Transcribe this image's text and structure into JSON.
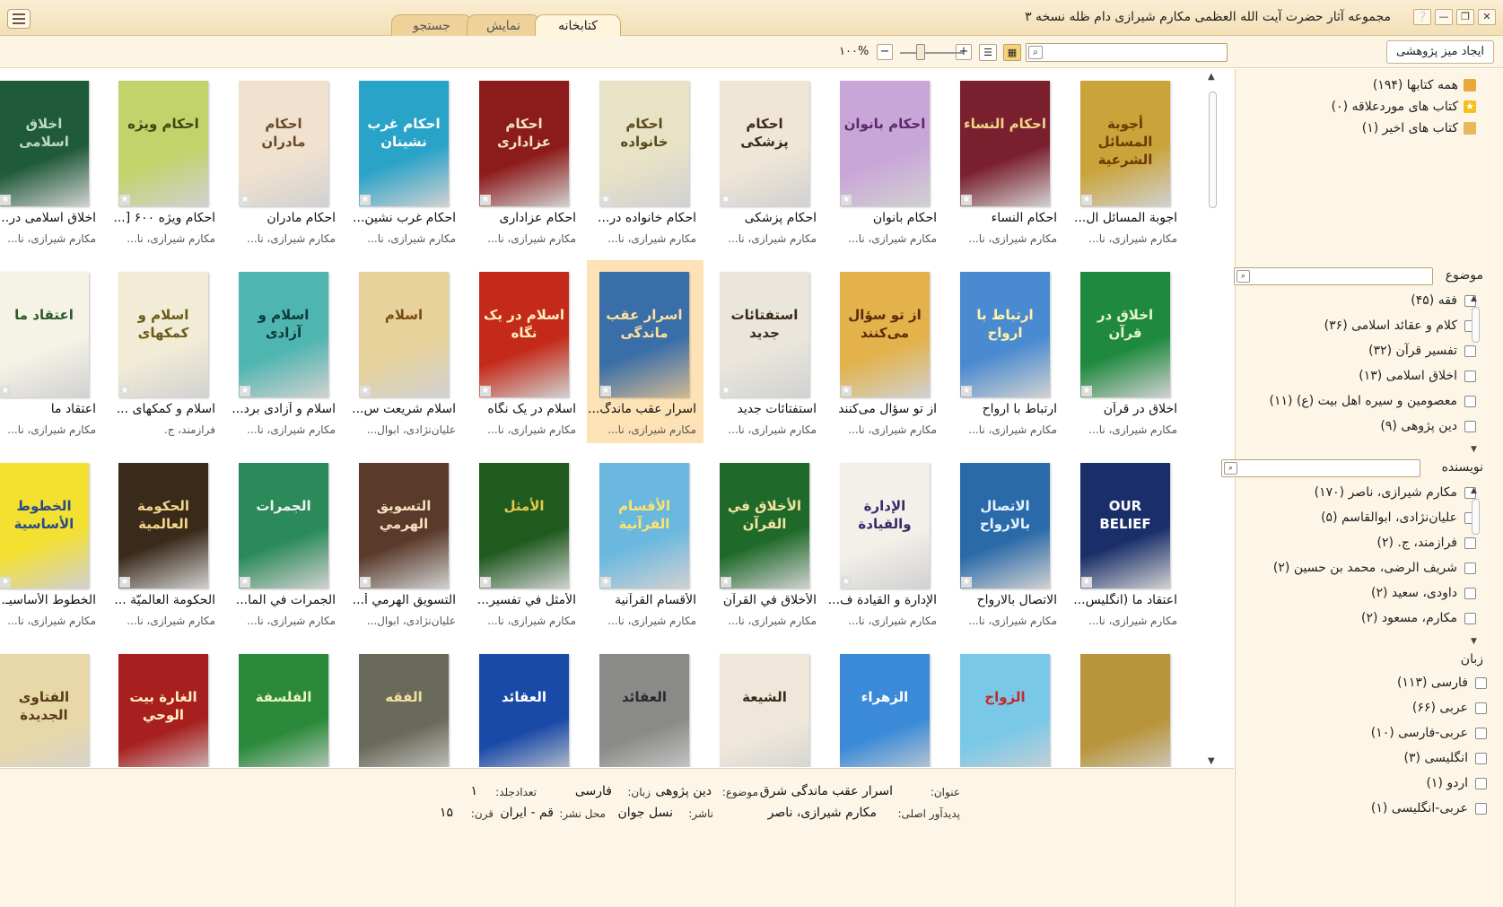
{
  "window": {
    "title": "مجموعه آثار حضرت آیت الله العظمی مکارم شیرازی دام ظله نسخه ۳",
    "controls": [
      "❔",
      "—",
      "❐",
      "✕"
    ]
  },
  "tabs": [
    {
      "label": "کتابخانه",
      "active": true
    },
    {
      "label": "نمایش",
      "active": false
    },
    {
      "label": "جستجو",
      "active": false
    }
  ],
  "toolbar": {
    "research_desk_label": "ایجاد میز پژوهشی",
    "search_placeholder": "",
    "zoom_label": "۱۰۰%",
    "zoom_plus": "+",
    "zoom_minus": "−",
    "view_mode": "grid"
  },
  "books": [
    {
      "title": "اجوبة المسائل ال...",
      "author": "مکارم شیرازی، نا...",
      "cover_title": "أجوبة المسائل الشرعية",
      "bg": "#caa43a",
      "fg": "#6b3b00"
    },
    {
      "title": "احکام النساء",
      "author": "مکارم شیرازی، نا...",
      "cover_title": "احکام النساء",
      "bg": "#7a1f2e",
      "fg": "#f3d58a"
    },
    {
      "title": "احکام بانوان",
      "author": "مکارم شیرازی، نا...",
      "cover_title": "احکام بانوان",
      "bg": "#c9a6d8",
      "fg": "#5a2a6a"
    },
    {
      "title": "احکام پزشکی",
      "author": "مکارم شیرازی، نا...",
      "cover_title": "احکام پزشکی",
      "bg": "#efe6d6",
      "fg": "#3a2a1a"
    },
    {
      "title": "احکام خانواده در...",
      "author": "مکارم شیرازی، نا...",
      "cover_title": "احکام خانواده",
      "bg": "#e8e2c6",
      "fg": "#5b4a1a"
    },
    {
      "title": "احکام عزاداری",
      "author": "مکارم شیرازی، نا...",
      "cover_title": "احکام عزاداری",
      "bg": "#8c1b1b",
      "fg": "#f3e4c4"
    },
    {
      "title": "احکام غرب نشین...",
      "author": "مکارم شیرازی، نا...",
      "cover_title": "احکام غرب نشینان",
      "bg": "#2aa3c9",
      "fg": "#ffffff"
    },
    {
      "title": "احکام مادران",
      "author": "مکارم شیرازی، نا...",
      "cover_title": "احکام مادران",
      "bg": "#f1e2cf",
      "fg": "#6b4a2a"
    },
    {
      "title": "احکام ویژه ۶۰۰ [...",
      "author": "مکارم شیرازی، نا...",
      "cover_title": "احکام ویژه",
      "bg": "#c3d36b",
      "fg": "#3a4a10"
    },
    {
      "title": "اخلاق اسلامی در...",
      "author": "مکارم شیرازی، نا...",
      "cover_title": "اخلاق اسلامی",
      "bg": "#1f5a3a",
      "fg": "#bcd9c4"
    },
    {
      "title": "اخلاق در قرآن",
      "author": "مکارم شیرازی، نا...",
      "cover_title": "اخلاق در قرآن",
      "bg": "#1f8a3f",
      "fg": "#e8f3d0"
    },
    {
      "title": "ارتباط با ارواح",
      "author": "مکارم شیرازی، نا...",
      "cover_title": "ارتباط با ارواح",
      "bg": "#4a8ad0",
      "fg": "#fff3a8"
    },
    {
      "title": "از تو سؤال می‌کنند",
      "author": "مکارم شیرازی، نا...",
      "cover_title": "از تو سؤال می‌کنند",
      "bg": "#e3b24a",
      "fg": "#5a2a10"
    },
    {
      "title": "استفتائات جدید",
      "author": "مکارم شیرازی، نا...",
      "cover_title": "استفتائات جدید",
      "bg": "#eae6dc",
      "fg": "#3a2a1a"
    },
    {
      "title": "اسرار عقب ماندگ...",
      "author": "مکارم شیرازی، نا...",
      "cover_title": "اسرار عقب ماندگی",
      "bg": "#3a6ea8",
      "fg": "#ffe0a0",
      "selected": true
    },
    {
      "title": "اسلام در یک نگاه",
      "author": "مکارم شیرازی، نا...",
      "cover_title": "اسلام در یک نگاه",
      "bg": "#c42a1a",
      "fg": "#fff2c0"
    },
    {
      "title": "اسلام شریعت س...",
      "author": "علیان‌نژادی، ابوال...",
      "cover_title": "اسلام",
      "bg": "#e6d29a",
      "fg": "#7a4a10"
    },
    {
      "title": "اسلام و آزادی برد...",
      "author": "مکارم شیرازی، نا...",
      "cover_title": "اسلام و آزادی",
      "bg": "#4fb5b0",
      "fg": "#0a3a3a"
    },
    {
      "title": "اسلام و کمکهای ...",
      "author": "فرازمند، ج.",
      "cover_title": "اسلام و کمکهای",
      "bg": "#f2ecd6",
      "fg": "#6a5a1a"
    },
    {
      "title": "اعتقاد ما",
      "author": "مکارم شیرازی، نا...",
      "cover_title": "اعتقاد ما",
      "bg": "#f5f2e6",
      "fg": "#2a5a2a"
    },
    {
      "title": "اعتقاد ما (انگلیس...",
      "author": "مکارم شیرازی، نا...",
      "cover_title": "OUR BELIEF",
      "bg": "#1a2f6a",
      "fg": "#ffffff"
    },
    {
      "title": "الاتصال بالارواح",
      "author": "مکارم شیرازی، نا...",
      "cover_title": "الاتصال بالارواح",
      "bg": "#2a6aa8",
      "fg": "#e6f3ff"
    },
    {
      "title": "الإدارة و القیادة ف...",
      "author": "مکارم شیرازی، نا...",
      "cover_title": "الإدارة والقيادة",
      "bg": "#f3f0ea",
      "fg": "#3a2a6a"
    },
    {
      "title": "الأخلاق في القرآن",
      "author": "مکارم شیرازی، نا...",
      "cover_title": "الأخلاق في القرآن",
      "bg": "#1f6a2a",
      "fg": "#f3e4a0"
    },
    {
      "title": "الأقسام القرآنیة",
      "author": "مکارم شیرازی، نا...",
      "cover_title": "الأقسام القرآنية",
      "bg": "#6ab8e0",
      "fg": "#ffe46a"
    },
    {
      "title": "الأمثل في تفسیر...",
      "author": "مکارم شیرازی، نا...",
      "cover_title": "الأمثل",
      "bg": "#1f5a1f",
      "fg": "#e8c84a"
    },
    {
      "title": "التسویق الهرمي أ...",
      "author": "علیان‌نژادی، ابوال...",
      "cover_title": "التسويق الهرمي",
      "bg": "#5a3a2a",
      "fg": "#f3e0c0"
    },
    {
      "title": "الجمرات في الما...",
      "author": "مکارم شیرازی، نا...",
      "cover_title": "الجمرات",
      "bg": "#2a8a5a",
      "fg": "#f3f3f3"
    },
    {
      "title": "الحکومة العالمیّة ...",
      "author": "مکارم شیرازی، نا...",
      "cover_title": "الحكومة العالمية",
      "bg": "#3a2a1a",
      "fg": "#f3d58a"
    },
    {
      "title": "الخطوط الأساسیـ...",
      "author": "مکارم شیرازی، نا...",
      "cover_title": "الخطوط الأساسية",
      "bg": "#f3e030",
      "fg": "#2a4a8a"
    },
    {
      "title": "",
      "author": "",
      "cover_title": "",
      "bg": "#b8943a",
      "fg": "#3a2a1a"
    },
    {
      "title": "",
      "author": "",
      "cover_title": "الزواج",
      "bg": "#7ac8e8",
      "fg": "#c02a2a"
    },
    {
      "title": "",
      "author": "",
      "cover_title": "الزهراء",
      "bg": "#3a8ad8",
      "fg": "#ffffff"
    },
    {
      "title": "",
      "author": "",
      "cover_title": "الشيعة",
      "bg": "#efe8da",
      "fg": "#3a2a1a"
    },
    {
      "title": "",
      "author": "",
      "cover_title": "العقائد",
      "bg": "#8a8a88",
      "fg": "#2a2a2a"
    },
    {
      "title": "",
      "author": "",
      "cover_title": "العقائد",
      "bg": "#1a4aa8",
      "fg": "#ffffff"
    },
    {
      "title": "",
      "author": "",
      "cover_title": "الفقه",
      "bg": "#6a6a5a",
      "fg": "#f3e0a0"
    },
    {
      "title": "",
      "author": "",
      "cover_title": "الفلسفة",
      "bg": "#2a8a3a",
      "fg": "#e8f3c0"
    },
    {
      "title": "",
      "author": "",
      "cover_title": "الغارة بيت الوحي",
      "bg": "#a81f1f",
      "fg": "#fff2c0"
    },
    {
      "title": "",
      "author": "",
      "cover_title": "الفتاوى الجديدة",
      "bg": "#e8d8a8",
      "fg": "#5a3a1a"
    }
  ],
  "info": {
    "title_label": "عنوان:",
    "title_value": "اسرار عقب ماندگی شرق",
    "subject_label": "موضوع:",
    "subject_value": "دین پژوهی",
    "language_label": "زبان:",
    "language_value": "فارسی",
    "volumes_label": "تعدادجلد:",
    "volumes_value": "۱",
    "author_label": "پدیدآور اصلی:",
    "author_value": "مکارم شیرازی، ناصر",
    "publisher_label": "ناشر:",
    "publisher_value": "نسل جوان",
    "place_label": "محل نشر:",
    "place_value": "قم - ایران",
    "century_label": "قرن:",
    "century_value": "۱۵"
  },
  "library": [
    {
      "label": "همه کتابها (۱۹۴)",
      "icon": "books-icon",
      "color": "#e8a83a"
    },
    {
      "label": "کتاب های موردعلاقه (۰)",
      "icon": "star-icon",
      "color": "#f3c020"
    },
    {
      "label": "کتاب های اخیر (۱)",
      "icon": "recent-books-icon",
      "color": "#e8b85a"
    }
  ],
  "facets": {
    "subject": {
      "title": "موضوع",
      "items": [
        "فقه (۴۵)",
        "کلام و عقائد اسلامی (۳۶)",
        "تفسیر قرآن (۳۲)",
        "اخلاق اسلامی (۱۳)",
        "معصومین و سیره اهل بیت (ع) (۱۱)",
        "دین پژوهی (۹)"
      ]
    },
    "author": {
      "title": "نویسنده",
      "items": [
        "مکارم شیرازی، ناصر (۱۷۰)",
        "علیان‌نژادی، ابوالقاسم (۵)",
        "فرازمند، ج. (۲)",
        "شریف الرضی، محمد بن حسین (۲)",
        "داودی، سعید (۲)",
        "مکارم، مسعود (۲)"
      ]
    },
    "language": {
      "title": "زبان",
      "items": [
        "فارسی (۱۱۳)",
        "عربی (۶۶)",
        "عربی-فارسی (۱۰)",
        "انگلیسی (۳)",
        "اردو (۱)",
        "عربی-انگلیسی (۱)"
      ]
    }
  }
}
